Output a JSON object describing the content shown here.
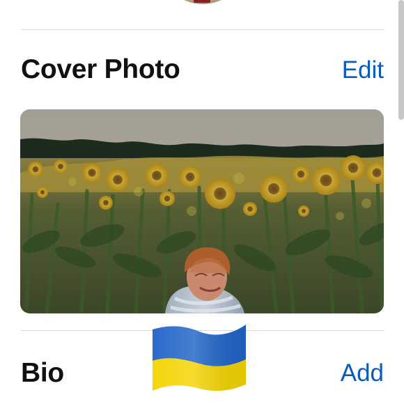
{
  "profile": {
    "profile_photo_icon": "profile-photo"
  },
  "cover": {
    "title": "Cover Photo",
    "edit_label": "Edit",
    "image_icon": "sunflower-field-photo"
  },
  "bio": {
    "title": "Bio",
    "add_label": "Add"
  },
  "overlay": {
    "flag_icon": "ukraine-flag"
  },
  "colors": {
    "link": "#0b5bbc",
    "title": "#111111",
    "divider": "#dedede",
    "flag_blue": "#1f63c7",
    "flag_yellow": "#f3d300"
  }
}
